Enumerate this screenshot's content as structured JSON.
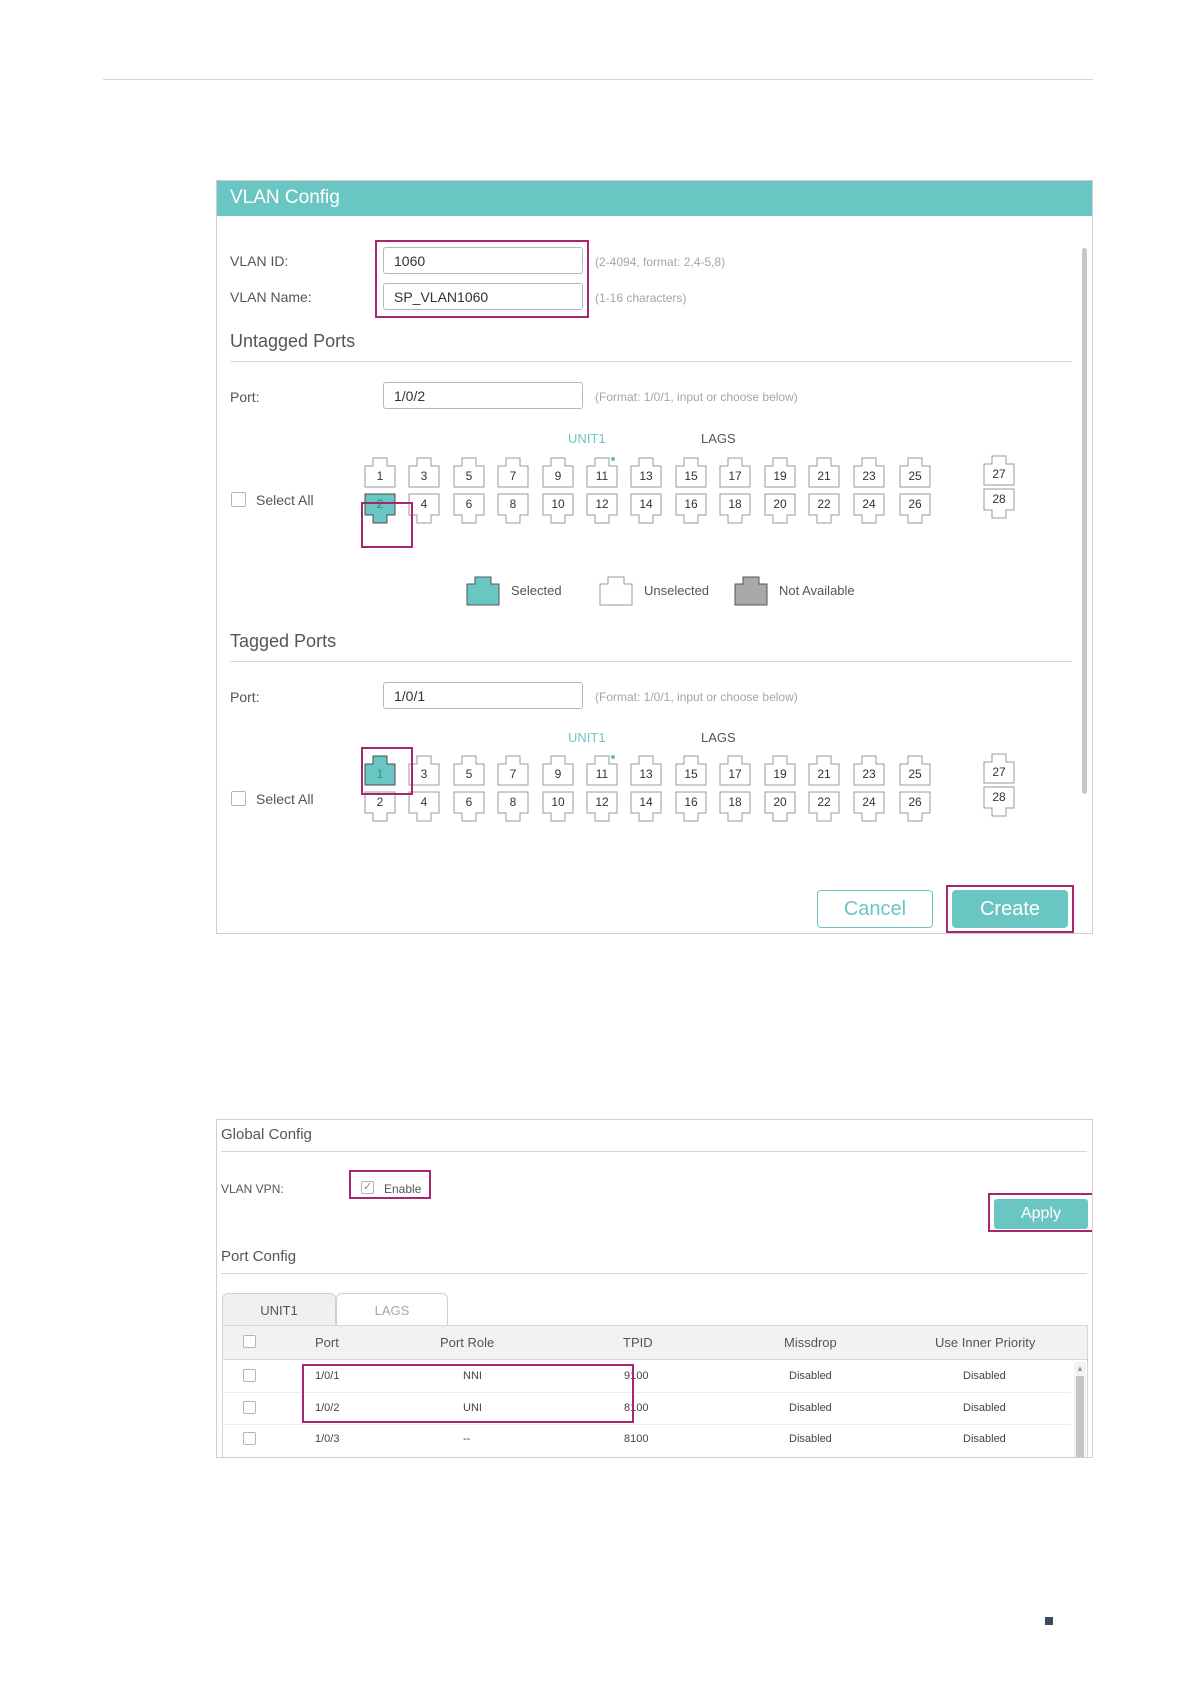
{
  "vlan_config": {
    "title": "VLAN Config",
    "vlan_id_label": "VLAN ID:",
    "vlan_id_value": "1060",
    "vlan_id_hint": "(2-4094, format: 2,4-5,8)",
    "vlan_name_label": "VLAN Name:",
    "vlan_name_value": "SP_VLAN1060",
    "vlan_name_hint": "(1-16 characters)",
    "untagged": {
      "title": "Untagged Ports",
      "port_label": "Port:",
      "port_value": "1/0/2",
      "port_hint": "(Format: 1/0/1, input or choose below)",
      "unit_label": "UNIT1",
      "lags_label": "LAGS",
      "select_all": "Select All",
      "top_ports": [
        "1",
        "3",
        "5",
        "7",
        "9",
        "11",
        "13",
        "15",
        "17",
        "19",
        "21",
        "23",
        "25"
      ],
      "bottom_ports": [
        "2",
        "4",
        "6",
        "8",
        "10",
        "12",
        "14",
        "16",
        "18",
        "20",
        "22",
        "24",
        "26"
      ],
      "lag_top": "27",
      "lag_bottom": "28",
      "selected": [
        "2"
      ]
    },
    "legend": {
      "selected": "Selected",
      "unselected": "Unselected",
      "not_available": "Not Available"
    },
    "tagged": {
      "title": "Tagged Ports",
      "port_label": "Port:",
      "port_value": "1/0/1",
      "port_hint": "(Format: 1/0/1, input or choose below)",
      "unit_label": "UNIT1",
      "lags_label": "LAGS",
      "select_all": "Select All",
      "top_ports": [
        "1",
        "3",
        "5",
        "7",
        "9",
        "11",
        "13",
        "15",
        "17",
        "19",
        "21",
        "23",
        "25"
      ],
      "bottom_ports": [
        "2",
        "4",
        "6",
        "8",
        "10",
        "12",
        "14",
        "16",
        "18",
        "20",
        "22",
        "24",
        "26"
      ],
      "lag_top": "27",
      "lag_bottom": "28",
      "selected": [
        "1"
      ]
    },
    "cancel_label": "Cancel",
    "create_label": "Create"
  },
  "global_config": {
    "title": "Global Config",
    "vlan_vpn_label": "VLAN VPN:",
    "enable_label": "Enable",
    "enabled": true,
    "apply_label": "Apply",
    "port_config_title": "Port Config",
    "tabs": [
      {
        "label": "UNIT1",
        "active": true
      },
      {
        "label": "LAGS",
        "active": false
      }
    ],
    "table": {
      "columns": [
        "Port",
        "Port Role",
        "TPID",
        "Missdrop",
        "Use Inner Priority"
      ],
      "rows": [
        {
          "port": "1/0/1",
          "role": "NNI",
          "tpid": "9100",
          "missdrop": "Disabled",
          "inner": "Disabled"
        },
        {
          "port": "1/0/2",
          "role": "UNI",
          "tpid": "8100",
          "missdrop": "Disabled",
          "inner": "Disabled"
        },
        {
          "port": "1/0/3",
          "role": "--",
          "tpid": "8100",
          "missdrop": "Disabled",
          "inner": "Disabled"
        }
      ]
    }
  },
  "colors": {
    "accent": "#6ac6c3",
    "highlight": "#a8256f",
    "not_available": "#a9a9a9",
    "link_dot": "#5fd07a"
  }
}
